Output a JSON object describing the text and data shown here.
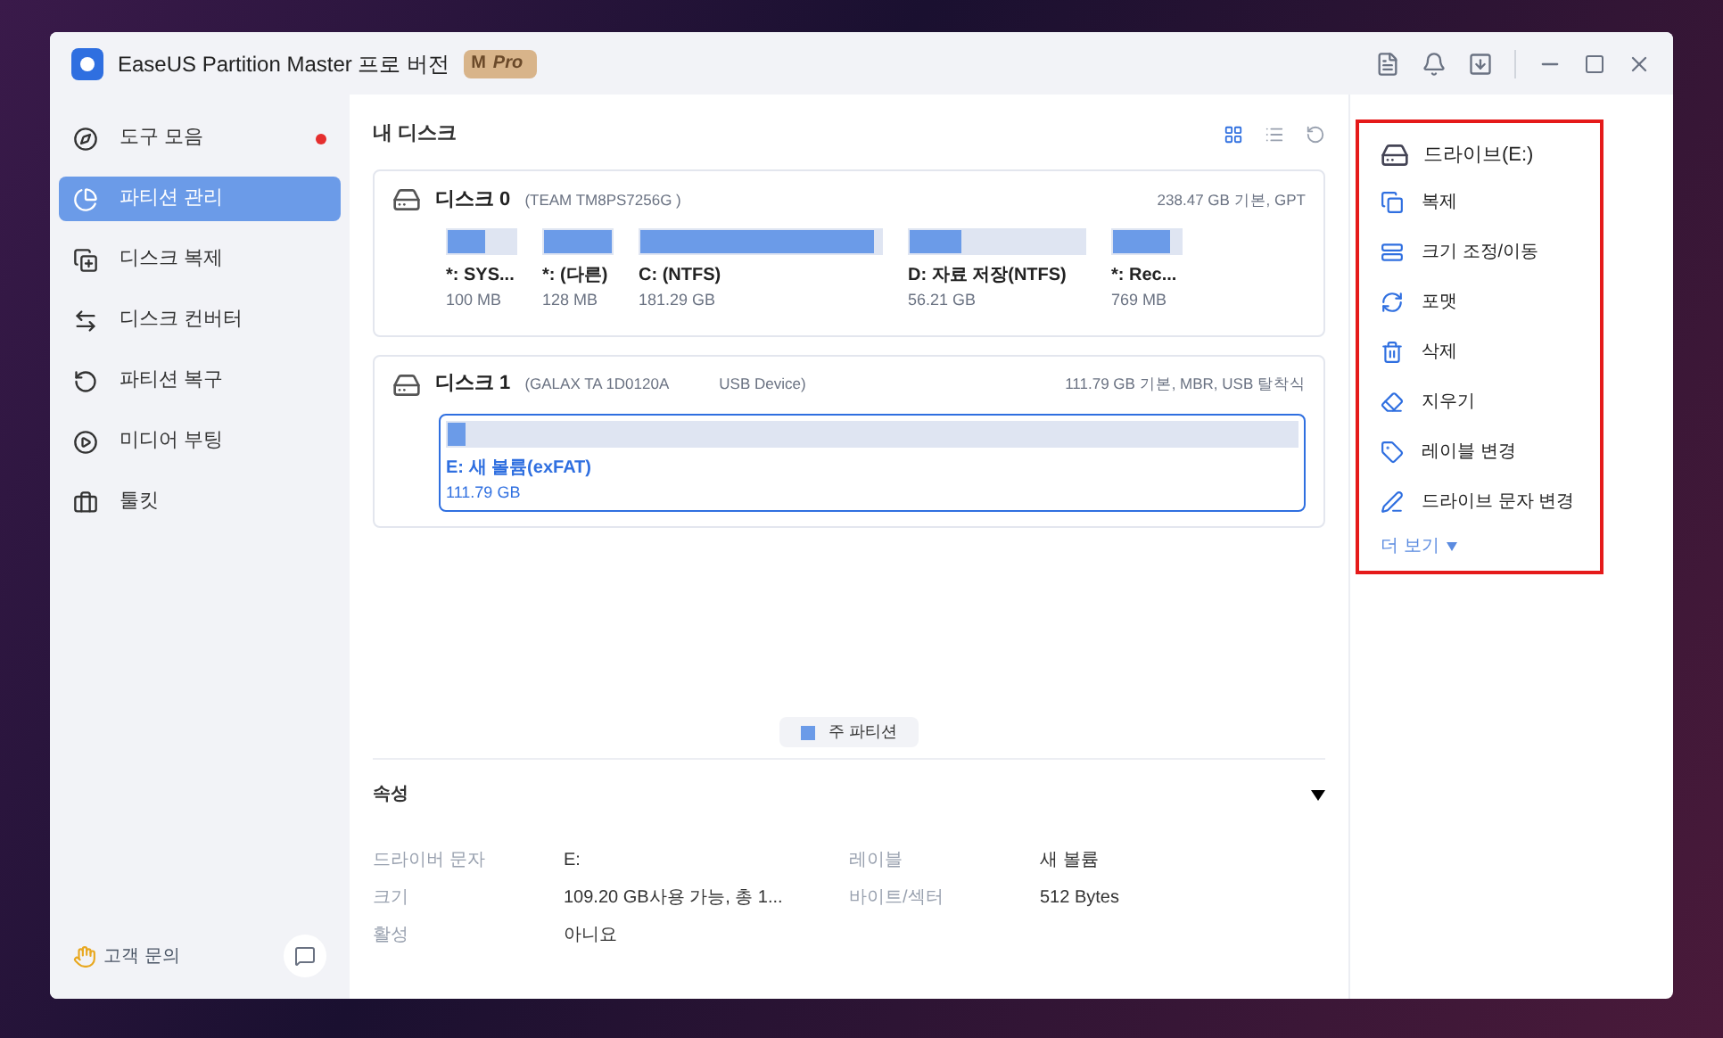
{
  "window": {
    "title": "EaseUS Partition Master 프로 버전",
    "badge_letter": "M",
    "badge": "Pro"
  },
  "sidebar": {
    "items": [
      {
        "label": "도구 모음",
        "selected": false,
        "notify": true
      },
      {
        "label": "파티션 관리",
        "selected": true,
        "notify": false
      },
      {
        "label": "디스크 복제",
        "selected": false,
        "notify": false
      },
      {
        "label": "디스크 컨버터",
        "selected": false,
        "notify": false
      },
      {
        "label": "파티션 복구",
        "selected": false,
        "notify": false
      },
      {
        "label": "미디어 부팅",
        "selected": false,
        "notify": false
      },
      {
        "label": "툴킷",
        "selected": false,
        "notify": false
      }
    ],
    "support": "고객 문의"
  },
  "main": {
    "title": "내 디스크",
    "disks": [
      {
        "name": "디스크 0",
        "model": "(TEAM TM8PS7256G )",
        "info": "238.47 GB 기본, GPT",
        "kind": "multi",
        "partitions": [
          {
            "label": "*: SYS...",
            "size": "100 MB",
            "level": 0.55
          },
          {
            "label": "*: (다른)",
            "size": "128 MB",
            "level": 1
          },
          {
            "label": "C: (NTFS)",
            "size": "181.29 GB",
            "level": 0.97
          },
          {
            "label": "D: 자료 저장(NTFS)",
            "size": "56.21 GB",
            "level": 0.3
          },
          {
            "label": "*: Rec...",
            "size": "769 MB",
            "level": 0.85
          }
        ]
      },
      {
        "name": "디스크 1",
        "model": "(GALAX TA 1D0120A",
        "device": "USB Device)",
        "info": "111.79 GB 기본, MBR, USB 탈착식",
        "kind": "single",
        "partitions": [
          {
            "label": "E: 새 볼륨(exFAT)",
            "size": "111.79 GB",
            "level": 0.02,
            "selected": true
          }
        ]
      }
    ],
    "legend": "주 파티션",
    "properties": {
      "title": "속성",
      "rows": [
        {
          "label": "드라이버 문자",
          "value": "E:"
        },
        {
          "label": "레이블",
          "value": "새 볼륨"
        },
        {
          "label": "크기",
          "value": "109.20 GB사용 가능,  총 1..."
        },
        {
          "label": "바이트/섹터",
          "value": "512 Bytes"
        },
        {
          "label": "활성",
          "value": "아니요"
        }
      ]
    }
  },
  "actions": {
    "header": "드라이브(E:)",
    "items": [
      {
        "label": "복제"
      },
      {
        "label": "크기 조정/이동"
      },
      {
        "label": "포맷"
      },
      {
        "label": "삭제"
      },
      {
        "label": "지우기"
      },
      {
        "label": "레이블 변경"
      },
      {
        "label": "드라이브 문자 변경"
      }
    ],
    "more": "더 보기"
  }
}
